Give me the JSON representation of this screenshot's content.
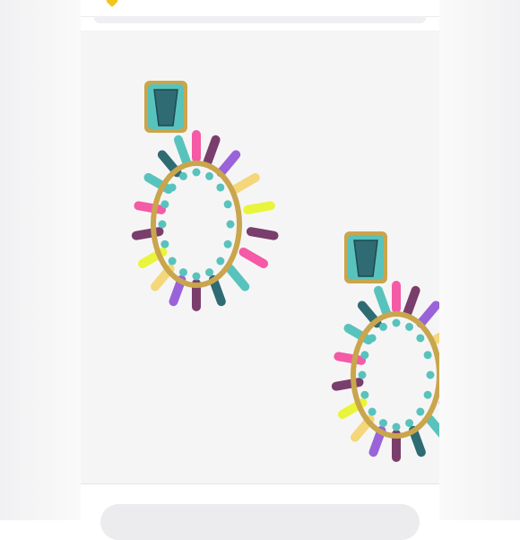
{
  "colors": {
    "gold": "#c9a54c",
    "turquoise": "#58c3bd",
    "teal_stone": "#2f6b72",
    "pink": "#f45aa6",
    "neon_yellow": "#e9f53a",
    "purple": "#9a63d9",
    "amethyst": "#7a3e6c",
    "citrine": "#f3d77a",
    "badge_yellow": "#f2c51b"
  },
  "icons": {
    "top_badge": "yellow-diamond-badge"
  },
  "listing": {
    "photo": "product-photo-earrings"
  }
}
